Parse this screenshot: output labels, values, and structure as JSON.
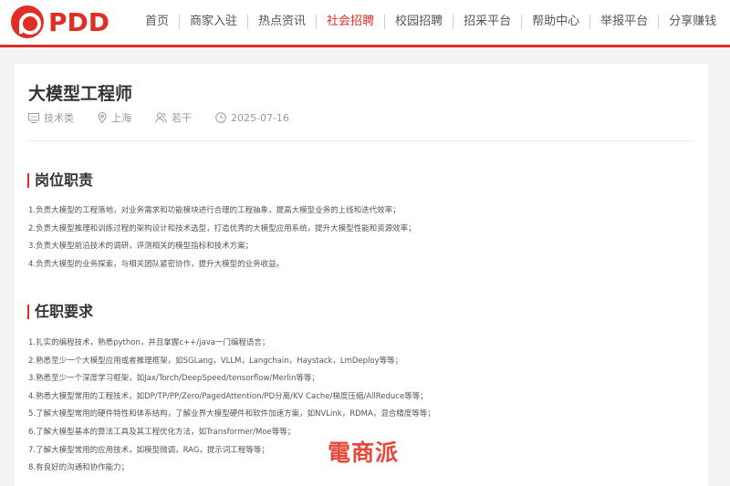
{
  "header": {
    "logo_text": "PDD",
    "nav": [
      {
        "label": "首页",
        "active": false
      },
      {
        "label": "商家入驻",
        "active": false
      },
      {
        "label": "热点资讯",
        "active": false
      },
      {
        "label": "社会招聘",
        "active": true
      },
      {
        "label": "校园招聘",
        "active": false
      },
      {
        "label": "招采平台",
        "active": false
      },
      {
        "label": "帮助中心",
        "active": false
      },
      {
        "label": "举报平台",
        "active": false
      },
      {
        "label": "分享赚钱",
        "active": false
      }
    ],
    "accent_color": "#e02e24"
  },
  "job": {
    "title": "大模型工程师",
    "category": "技术类",
    "location": "上海",
    "headcount": "若干",
    "date": "2025-07-16"
  },
  "responsibilities": {
    "title": "岗位职责",
    "items": [
      "1.负责大模型的工程落地，对业务需求和功能模块进行合理的工程抽象，提高大模型业务的上线和迭代效率；",
      "2.负责大模型推理和训练过程的架构设计和技术选型，打造优秀的大模型应用系统，提升大模型性能和资源效率；",
      "3.负责大模型前沿技术的调研，评测相关的模型指标和技术方案；",
      "4.负责大模型的业务探索，与相关团队紧密协作，提升大模型的业务收益。"
    ]
  },
  "requirements": {
    "title": "任职要求",
    "items": [
      "1.扎实的编程技术，熟悉python，并且掌握c++/java一门编程语言；",
      "2.熟悉至少一个大模型应用或者推理框架，如SGLang，VLLM，Langchain，Haystack，LmDeploy等等；",
      "3.熟悉至少一个深度学习框架，如Jax/Torch/DeepSpeed/tensorflow/Merlin等等；",
      "4.熟悉大模型常用的工程技术，如DP/TP/PP/Zero/PagedAttention/PD分离/KV Cache/梯度压缩/AllReduce等等；",
      "5.了解大模型常用的硬件特性和体系结构，了解业界大模型硬件和软件加速方案，如NVLink，RDMA，混合精度等等；",
      "6.了解大模型基本的算法工具及其工程优化方法，如Transformer/Moe等等；",
      "7.了解大模型常用的应用技术，如模型微调，RAG，提示词工程等等；",
      "8.有良好的沟通和协作能力；"
    ]
  },
  "watermark_text": "電商派"
}
